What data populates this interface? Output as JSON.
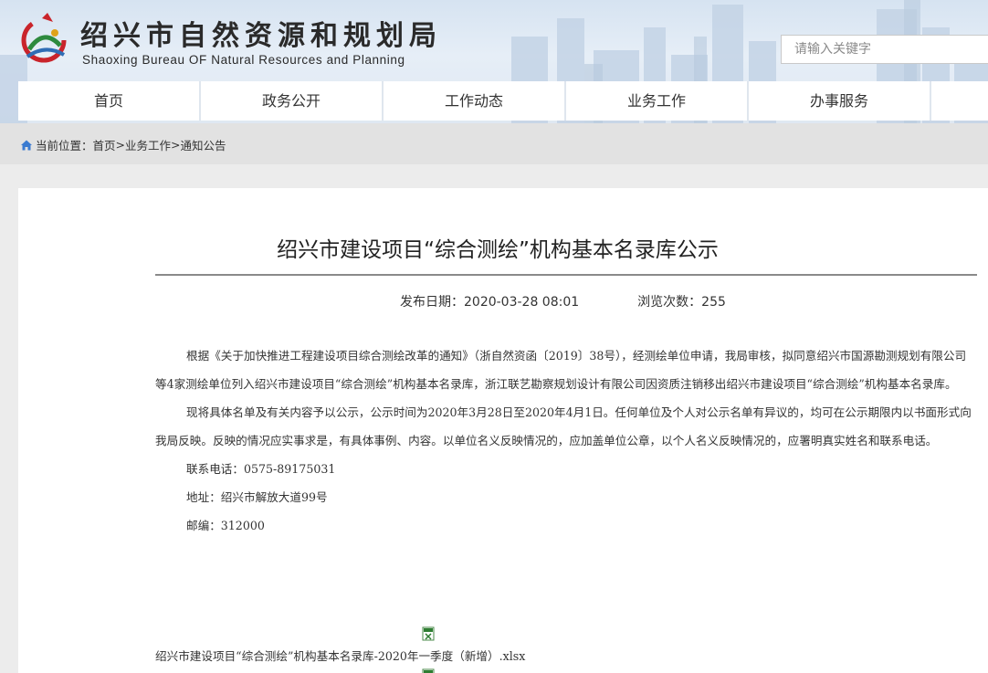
{
  "header": {
    "site_title": "绍兴市自然资源和规划局",
    "site_subtitle": "Shaoxing Bureau OF Natural Resources and Planning",
    "search_placeholder": "请输入关键字"
  },
  "nav": {
    "items": [
      {
        "label": "首页"
      },
      {
        "label": "政务公开"
      },
      {
        "label": "工作动态"
      },
      {
        "label": "业务工作"
      },
      {
        "label": "办事服务"
      }
    ]
  },
  "breadcrumb": {
    "prefix": "当前位置：",
    "items": [
      "首页",
      "业务工作",
      "通知公告"
    ],
    "separator": ">"
  },
  "article": {
    "title": "绍兴市建设项目“综合测绘”机构基本名录库公示",
    "publish_label": "发布日期：",
    "publish_date": "2020-03-28 08:01",
    "views_label": "浏览次数：",
    "views": "255",
    "paragraphs": [
      "根据《关于加快推进工程建设项目综合测绘改革的通知》（浙自然资函〔2019〕38号），经测绘单位申请，我局审核，拟同意绍兴市国源勘测规划有限公司等4家测绘单位列入绍兴市建设项目“综合测绘”机构基本名录库，浙江联艺勘察规划设计有限公司因资质注销移出绍兴市建设项目“综合测绘”机构基本名录库。",
      "现将具体名单及有关内容予以公示，公示时间为2020年3月28日至2020年4月1日。任何单位及个人对公示名单有异议的，均可在公示期限内以书面形式向我局反映。反映的情况应实事求是，有具体事例、内容。以单位名义反映情况的，应加盖单位公章，以个人名义反映情况的，应署明真实姓名和联系电话。"
    ],
    "contact_phone": "联系电话：0575-89175031",
    "address": "地址：绍兴市解放大道99号",
    "postcode": "邮编：312000",
    "attachment": "绍兴市建设项目“综合测绘”机构基本名录库-2020年一季度（新增）.xlsx"
  },
  "colors": {
    "banner_bg": "#d6e3f1",
    "nav_divider": "#dfe6ee",
    "crumb_bg": "#e2e2e2",
    "page_bg": "#ececec"
  },
  "icons": [
    "party-logo-icon",
    "home-icon",
    "excel-file-icon"
  ]
}
